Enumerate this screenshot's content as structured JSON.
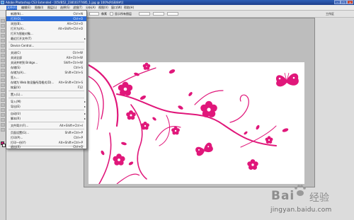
{
  "titlebar": {
    "title": "Adobe Photoshop CS3 Extended - [05VB52_23810377485_1.jpg @ 100%(RGB/8#)]"
  },
  "menubar": {
    "items": [
      "文件(F)",
      "编辑(E)",
      "图像(I)",
      "图层(L)",
      "选择(S)",
      "滤镜(T)",
      "分析(A)",
      "视图(V)",
      "窗口(W)",
      "帮助(H)"
    ]
  },
  "options_bar": {
    "mode_label": "像素",
    "fit_label": "显示所有图层",
    "workspace_label": "工作区"
  },
  "file_menu": {
    "items": [
      {
        "label": "新建(N)...",
        "shortcut": "Ctrl+N"
      },
      {
        "label": "打开(O)...",
        "shortcut": "Ctrl+O",
        "highlighted": true
      },
      {
        "label": "浏览(B)...",
        "shortcut": "Alt+Ctrl+O"
      },
      {
        "label": "打开为(A)...",
        "shortcut": "Alt+Shift+Ctrl+O"
      },
      {
        "label": "打开为智能对象...",
        "shortcut": ""
      },
      {
        "label": "最近打开文件(T)",
        "shortcut": "",
        "submenu": true
      },
      {
        "label": "Device Central...",
        "shortcut": ""
      },
      {
        "label": "关闭(C)",
        "shortcut": "Ctrl+W"
      },
      {
        "label": "关闭全部",
        "shortcut": "Alt+Ctrl+W"
      },
      {
        "label": "关闭并转到 Bridge...",
        "shortcut": "Shift+Ctrl+W"
      },
      {
        "label": "存储(S)",
        "shortcut": "Ctrl+S"
      },
      {
        "label": "存储为(A)...",
        "shortcut": "Shift+Ctrl+S"
      },
      {
        "label": "签入...",
        "shortcut": ""
      },
      {
        "label": "存储为 Web 和设备所用格式(D)...",
        "shortcut": "Alt+Shift+Ctrl+S"
      },
      {
        "label": "恢复(V)",
        "shortcut": "F12"
      },
      {
        "label": "置入(L)...",
        "shortcut": ""
      },
      {
        "label": "导入(M)",
        "shortcut": "",
        "submenu": true
      },
      {
        "label": "导出(E)",
        "shortcut": "",
        "submenu": true
      },
      {
        "label": "自动(U)",
        "shortcut": "",
        "submenu": true
      },
      {
        "label": "脚本(R)",
        "shortcut": "",
        "submenu": true
      },
      {
        "label": "文件简介(F)...",
        "shortcut": "Alt+Shift+Ctrl+I"
      },
      {
        "label": "页面设置(G)...",
        "shortcut": "Shift+Ctrl+P"
      },
      {
        "label": "打印(P)...",
        "shortcut": "Ctrl+P"
      },
      {
        "label": "打印一份(Y)",
        "shortcut": "Alt+Shift+Ctrl+P"
      },
      {
        "label": "退出(X)",
        "shortcut": "Ctrl+Q"
      }
    ]
  },
  "watermark": {
    "brand": "Bai",
    "brand_cn": "经验",
    "url": "jingyan.baidu.com"
  },
  "colors": {
    "flower": "#e0177a",
    "menu_highlight": "#2f6ed8",
    "titlebar": "#2452a8"
  },
  "icons": [
    "app-icon",
    "minimize-icon",
    "maximize-icon",
    "close-icon",
    "submenu-arrow-icon",
    "baidu-paw-icon"
  ]
}
